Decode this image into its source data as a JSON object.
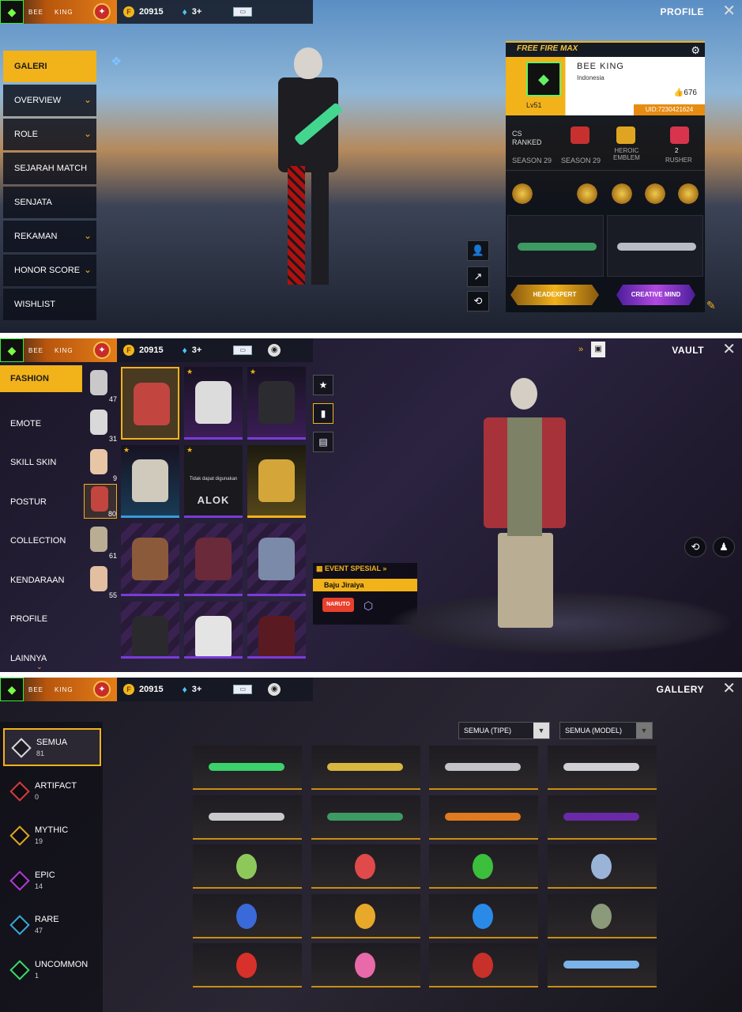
{
  "player": {
    "name": "BEE   KING",
    "short_name_a": "BEE",
    "short_name_b": "KING",
    "coins": "20915",
    "diamonds": "3+"
  },
  "panel1": {
    "title": "PROFILE",
    "menu": [
      {
        "label": "GALERI",
        "active": true
      },
      {
        "label": "OVERVIEW",
        "chevron": true
      },
      {
        "label": "ROLE",
        "chevron": true
      },
      {
        "label": "SEJARAH MATCH"
      },
      {
        "label": "SENJATA"
      },
      {
        "label": "REKAMAN",
        "chevron": true
      },
      {
        "label": "HONOR SCORE",
        "chevron": true
      },
      {
        "label": "WISHLIST"
      }
    ],
    "card": {
      "brand": "FREE FIRE MAX",
      "name": "BEE     KING",
      "country": "Indonesia",
      "level": "Lv51",
      "likes": "676",
      "uid": "UID:7230421624",
      "mode": "CS\nRANKED",
      "season_a": "SEASON 29",
      "season_b": "SEASON 29",
      "emblem": "HEROIC\nEMBLEM",
      "role": "RUSHER",
      "role_count": "2",
      "tag_a": "HEADEXPERT",
      "tag_b": "CREATIVE MIND"
    }
  },
  "panel2": {
    "title": "VAULT",
    "menu": [
      "FASHION",
      "EMOTE",
      "SKILL SKIN",
      "POSTUR",
      "COLLECTION",
      "KENDARAAN",
      "PROFILE",
      "LAINNYA"
    ],
    "categories": [
      {
        "count": "47"
      },
      {
        "count": "31"
      },
      {
        "count": "9"
      },
      {
        "count": "80"
      },
      {
        "count": "61"
      },
      {
        "count": "55"
      }
    ],
    "locked_text": "Tidak dapat digunakan",
    "alok": "ALOK",
    "event_header": "EVENT SPESIAL",
    "event_item": "Baju Jiraiya",
    "event_logo": "NARUTO"
  },
  "panel3": {
    "title": "GALLERY",
    "filter_type": "SEMUA (TIPE)",
    "filter_model": "SEMUA (MODEL)",
    "menu": [
      {
        "label": "SEMUA",
        "count": "81",
        "color": "#d9d9d9"
      },
      {
        "label": "ARTIFACT",
        "count": "0",
        "color": "#d93a3a"
      },
      {
        "label": "MYTHIC",
        "count": "19",
        "color": "#e0a520"
      },
      {
        "label": "EPIC",
        "count": "14",
        "color": "#b13ad9"
      },
      {
        "label": "RARE",
        "count": "47",
        "color": "#3aa7d9"
      },
      {
        "label": "UNCOMMON",
        "count": "1",
        "color": "#3ad96b"
      }
    ]
  },
  "colors": {
    "accent": "#f2b21a",
    "orange": "#e37d18",
    "purple": "#7a3bd8"
  }
}
